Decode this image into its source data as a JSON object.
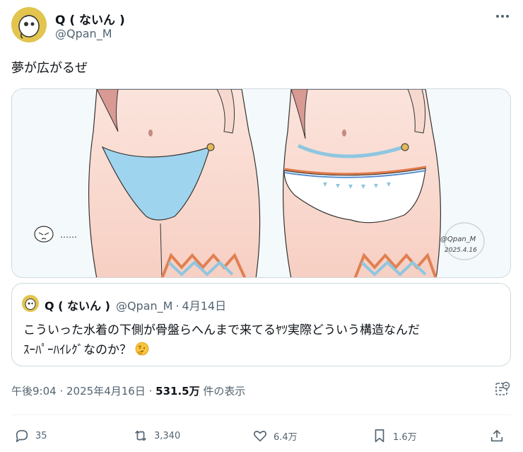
{
  "author": {
    "display_name": "Q ( ないん )",
    "handle": "@Qpan_M"
  },
  "tweet": {
    "text": "夢が広がるぜ"
  },
  "media": {
    "signature": "@Qpan_M",
    "signature_date": "2025.4.16",
    "dots": "……"
  },
  "quote": {
    "display_name": "Q ( ないん )",
    "handle": "@Qpan_M",
    "date": "4月14日",
    "line1": "こういった水着の下側が骨盤らへんまで来てるﾔﾂ実際どういう構造なんだ",
    "line2": "ｽｰﾊﾟｰﾊｲﾚｸﾞなのか？",
    "emoji": "thinking-face"
  },
  "meta": {
    "time": "午後9:04",
    "date": "2025年4月16日",
    "views_count": "531.5万",
    "views_label": "件の表示"
  },
  "actions": {
    "replies": "35",
    "retweets": "3,340",
    "likes": "6.4万",
    "bookmarks": "1.6万"
  },
  "colors": {
    "text_primary": "#0f1419",
    "text_secondary": "#536471",
    "border": "#cfd9de",
    "avatar_bg": "#e2c44e"
  }
}
